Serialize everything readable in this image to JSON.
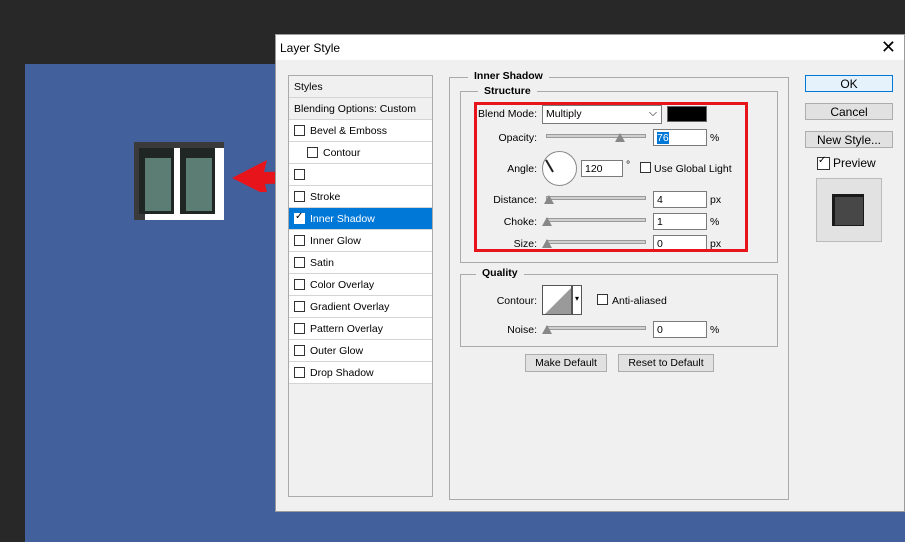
{
  "dialog": {
    "title": "Layer Style",
    "close": "✕"
  },
  "styles_header": "Styles",
  "blending": "Blending Options: Custom",
  "styles": [
    {
      "label": "Bevel & Emboss",
      "checked": false
    },
    {
      "label": "Contour",
      "checked": false
    },
    {
      "label": "",
      "checked": false
    },
    {
      "label": "Stroke",
      "checked": false
    },
    {
      "label": "Inner Shadow",
      "checked": true,
      "selected": true
    },
    {
      "label": "Inner Glow",
      "checked": false
    },
    {
      "label": "Satin",
      "checked": false
    },
    {
      "label": "Color Overlay",
      "checked": false
    },
    {
      "label": "Gradient Overlay",
      "checked": false
    },
    {
      "label": "Pattern Overlay",
      "checked": false
    },
    {
      "label": "Outer Glow",
      "checked": false
    },
    {
      "label": "Drop Shadow",
      "checked": false
    }
  ],
  "inner_shadow": {
    "title": "Inner Shadow",
    "structure": "Structure",
    "blend_mode_label": "Blend Mode:",
    "blend_mode": "Multiply",
    "color": "#000000",
    "opacity_label": "Opacity:",
    "opacity": "76",
    "opacity_level": 0.76,
    "percent": "%",
    "angle_label": "Angle:",
    "angle": "120",
    "degree": "°",
    "global_light": "Use Global Light",
    "distance_label": "Distance:",
    "distance": "4",
    "px": "px",
    "choke_label": "Choke:",
    "choke": "1",
    "size_label": "Size:",
    "size": "0"
  },
  "quality": {
    "title": "Quality",
    "contour_label": "Contour:",
    "anti_aliased": "Anti-aliased",
    "noise_label": "Noise:",
    "noise": "0",
    "percent": "%"
  },
  "buttons": {
    "make_default": "Make Default",
    "reset_default": "Reset to Default",
    "ok": "OK",
    "cancel": "Cancel",
    "new_style": "New Style...",
    "preview": "Preview"
  },
  "colors": {
    "canvas": "#42609c",
    "highlight": "#0078d7",
    "annotation": "#e8141b"
  }
}
